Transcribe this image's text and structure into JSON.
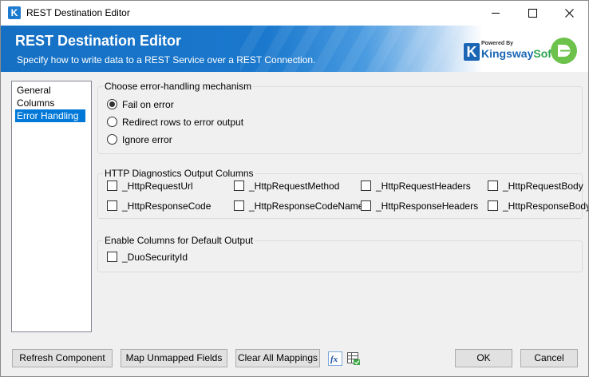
{
  "window": {
    "title": "REST Destination Editor",
    "app_icon_glyph": "K"
  },
  "banner": {
    "title": "REST Destination Editor",
    "subtitle": "Specify how to write data to a REST Service over a REST Connection.",
    "logo_powered_by": "Powered By",
    "logo_name_main": "Kingsway",
    "logo_name_accent": "Soft",
    "logo_icon_glyph": "K"
  },
  "nav": {
    "items": [
      {
        "label": "General",
        "selected": false
      },
      {
        "label": "Columns",
        "selected": false
      },
      {
        "label": "Error Handling",
        "selected": true
      }
    ]
  },
  "error_handling": {
    "title": "Choose error-handling mechanism",
    "options": [
      {
        "label": "Fail on error",
        "checked": true
      },
      {
        "label": "Redirect rows to error output",
        "checked": false
      },
      {
        "label": "Ignore error",
        "checked": false
      }
    ]
  },
  "diagnostics": {
    "title": "HTTP Diagnostics Output Columns",
    "columns": [
      {
        "label": "_HttpRequestUrl",
        "checked": false
      },
      {
        "label": "_HttpRequestMethod",
        "checked": false
      },
      {
        "label": "_HttpRequestHeaders",
        "checked": false
      },
      {
        "label": "_HttpRequestBody",
        "checked": false
      },
      {
        "label": "_HttpResponseCode",
        "checked": false
      },
      {
        "label": "_HttpResponseCodeName",
        "checked": false
      },
      {
        "label": "_HttpResponseHeaders",
        "checked": false
      },
      {
        "label": "_HttpResponseBody",
        "checked": false
      }
    ]
  },
  "default_output": {
    "title": "Enable Columns for Default Output",
    "columns": [
      {
        "label": "_DuoSecurityId",
        "checked": false
      }
    ]
  },
  "buttons": {
    "refresh": "Refresh Component",
    "map_unmapped": "Map Unmapped Fields",
    "clear_mappings": "Clear All Mappings",
    "expression_icon": "fx-icon",
    "grid_icon": "grid-settings-icon",
    "ok": "OK",
    "cancel": "Cancel"
  },
  "colors": {
    "banner_blue": "#1570c4",
    "selection_blue": "#0078d7",
    "duo_green": "#6cc24a",
    "logo_blue": "#1a66b5",
    "logo_green": "#2ea44f"
  }
}
